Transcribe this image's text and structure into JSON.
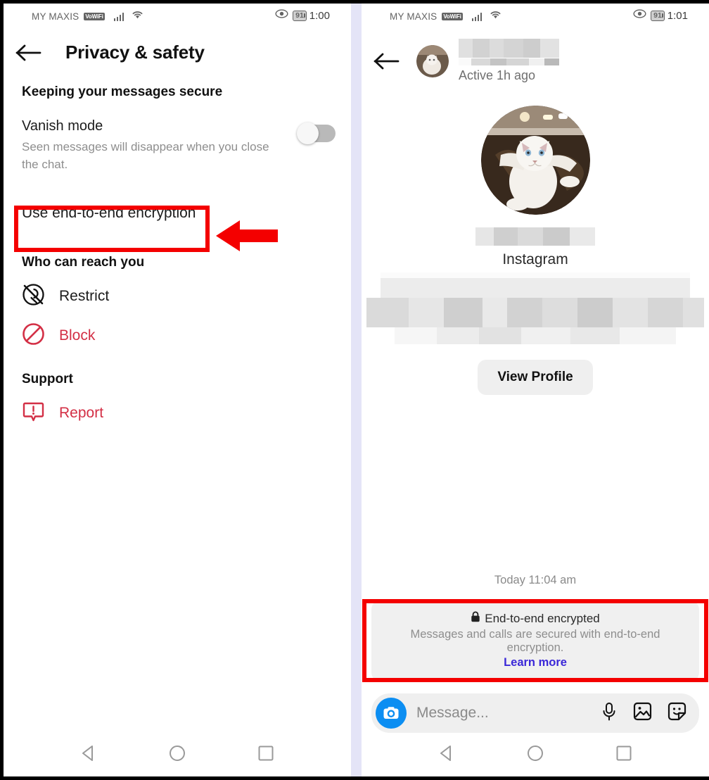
{
  "theme": {
    "accent_red": "#f40000",
    "danger_text": "#d32f45",
    "link_blue": "#3a27d8",
    "camera_blue": "#0c8ef2",
    "divider_lavender": "#e4e4f7"
  },
  "left_panel": {
    "status_bar": {
      "carrier": "MY MAXIS",
      "volte_badge": "VoWiFi",
      "battery": "91",
      "clock": "1:00",
      "icons": [
        "signal-bars-icon",
        "wifi-icon",
        "eye-icon",
        "battery-icon"
      ]
    },
    "header": {
      "back_icon": "back-arrow-icon",
      "title": "Privacy & safety"
    },
    "section_secure": {
      "heading": "Keeping your messages secure",
      "vanish_mode": {
        "title": "Vanish mode",
        "subtitle": "Seen messages will disappear when you close the chat.",
        "toggle_state": "off"
      },
      "e2e_row_label": "Use end-to-end encryption"
    },
    "section_reach": {
      "heading": "Who can reach you",
      "items": [
        {
          "label": "Restrict",
          "icon": "restrict-icon",
          "danger": false
        },
        {
          "label": "Block",
          "icon": "block-icon",
          "danger": true
        }
      ]
    },
    "section_support": {
      "heading": "Support",
      "items": [
        {
          "label": "Report",
          "icon": "report-icon",
          "danger": true
        }
      ]
    },
    "nav_bar": [
      "back-triangle-icon",
      "home-circle-icon",
      "recents-square-icon"
    ]
  },
  "right_panel": {
    "status_bar": {
      "carrier": "MY MAXIS",
      "volte_badge": "VoWiFi",
      "battery": "91",
      "clock": "1:01",
      "icons": [
        "signal-bars-icon",
        "wifi-icon",
        "eye-icon",
        "battery-icon"
      ]
    },
    "header": {
      "back_icon": "back-arrow-icon",
      "contact_name": "",
      "contact_name_redacted": true,
      "active_status": "Active 1h ago"
    },
    "profile": {
      "avatar_alt": "cat-profile-photo",
      "username": "",
      "username_redacted": true,
      "platform": "Instagram",
      "bio_redacted": true,
      "view_profile_label": "View Profile"
    },
    "conversation": {
      "timestamp": "Today 11:04 am",
      "encryption_notice": {
        "lock_icon": "lock-icon",
        "title": "End-to-end encrypted",
        "description": "Messages and calls are secured with end-to-end encryption.",
        "link_label": "Learn more"
      }
    },
    "composer": {
      "camera_icon": "camera-icon",
      "placeholder": "Message...",
      "icons": [
        "microphone-icon",
        "gallery-icon",
        "sticker-icon"
      ]
    },
    "nav_bar": [
      "back-triangle-icon",
      "home-circle-icon",
      "recents-square-icon"
    ]
  },
  "annotations": {
    "highlight_boxes": [
      "use-end-to-end-encryption-row",
      "end-to-end-encrypted-notice"
    ],
    "arrow": "left-pointing-red-arrow"
  }
}
